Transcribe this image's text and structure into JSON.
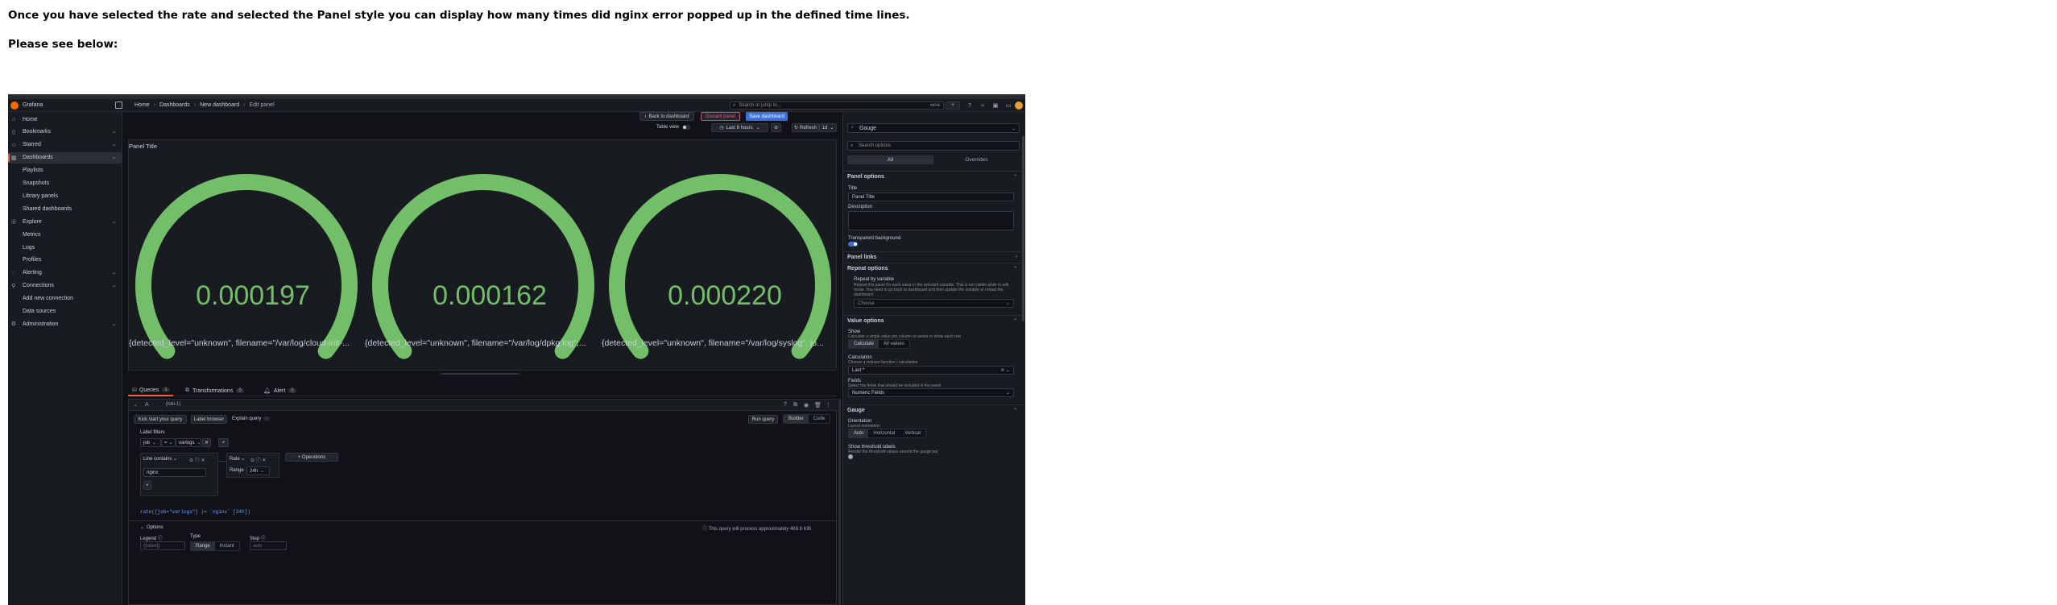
{
  "document": {
    "line1": "Once you have selected the rate and selected the Panel style you can display how many times did nginx error popped up in the defined time lines.",
    "line2": "Please see below:"
  },
  "nav": {
    "app_name": "Grafana",
    "breadcrumbs": [
      "Home",
      "Dashboards",
      "New dashboard",
      "Edit panel"
    ],
    "search_placeholder": "Search or jump to...",
    "search_shortcut": "ctrl+k",
    "new_label": "+"
  },
  "sidebar": {
    "items": [
      {
        "label": "Home",
        "icon": "home-icon",
        "sub": false,
        "chevron": false
      },
      {
        "label": "Bookmarks",
        "icon": "bookmark-icon",
        "sub": false,
        "chevron": true
      },
      {
        "label": "Starred",
        "icon": "star-icon",
        "sub": false,
        "chevron": true
      },
      {
        "label": "Dashboards",
        "icon": "dashboards-icon",
        "sub": false,
        "chevron": true,
        "active": true
      },
      {
        "label": "Playlists",
        "sub": true
      },
      {
        "label": "Snapshots",
        "sub": true
      },
      {
        "label": "Library panels",
        "sub": true
      },
      {
        "label": "Shared dashboards",
        "sub": true
      },
      {
        "label": "Explore",
        "icon": "compass-icon",
        "sub": false,
        "chevron": true
      },
      {
        "label": "Metrics",
        "sub": true
      },
      {
        "label": "Logs",
        "sub": true
      },
      {
        "label": "Profiles",
        "sub": true
      },
      {
        "label": "Alerting",
        "icon": "bell-icon",
        "sub": false,
        "chevron": true
      },
      {
        "label": "Connections",
        "icon": "plug-icon",
        "sub": false,
        "chevron": true
      },
      {
        "label": "Add new connection",
        "sub": true
      },
      {
        "label": "Data sources",
        "sub": true
      },
      {
        "label": "Administration",
        "icon": "gear-icon",
        "sub": false,
        "chevron": true
      }
    ]
  },
  "toolbar": {
    "back_to_dashboard": "Back to dashboard",
    "discard_panel": "Discard panel",
    "save_dashboard": "Save dashboard",
    "table_view": "Table view",
    "time_range": "Last 6 hours",
    "refresh": "Refresh",
    "refresh_interval": "1d"
  },
  "panel": {
    "title": "Panel Title",
    "gauges": [
      {
        "value": "0.000197",
        "fraction": 1.0,
        "label": "{detected_level=\"unknown\", filename=\"/var/log/cloud-init-..."
      },
      {
        "value": "0.000162",
        "fraction": 1.0,
        "label": "{detected_level=\"unknown\", filename=\"/var/log/dpkg.log\",..."
      },
      {
        "value": "0.000220",
        "fraction": 1.0,
        "label": "{detected_level=\"unknown\", filename=\"/var/log/syslog\", jo..."
      }
    ],
    "gauge_color": "#73bf69"
  },
  "tabs": [
    {
      "label": "Queries",
      "count": "1",
      "icon": "database-icon"
    },
    {
      "label": "Transformations",
      "count": "0",
      "icon": "transform-icon"
    },
    {
      "label": "Alert",
      "count": "0",
      "icon": "bell-icon"
    }
  ],
  "query": {
    "ref_id": "A",
    "datasource": "(loki-1)",
    "kick_start": "Kick start your query",
    "label_browser": "Label browser",
    "explain_query": "Explain query",
    "run_query": "Run query",
    "builder": "Builder",
    "code": "Code",
    "label_filters": "Label filters",
    "filter_label": "job",
    "filter_op": "=",
    "filter_value": "varlogs",
    "op1_name": "Line contains",
    "op1_value": "nginx",
    "op2_name": "Rate",
    "op2_range_label": "Range",
    "op2_range_value": "24h",
    "operations_btn": "+ Operations",
    "expr_prefix": "rate({job=\"varlogs\"} |= `nginx` [24h])",
    "options_label": "Options",
    "process_note": "This query will process approximately 469.8 KiB.",
    "legend_label": "Legend",
    "legend_placeholder": "{{label}}",
    "type_label": "Type",
    "type_range": "Range",
    "type_instant": "Instant",
    "step_label": "Step",
    "step_placeholder": "auto"
  },
  "options_pane": {
    "viz_name": "Gauge",
    "search_placeholder": "Search options",
    "tab_all": "All",
    "tab_overrides": "Overrides",
    "panel_options": "Panel options",
    "title_label": "Title",
    "title_value": "Panel Title",
    "description_label": "Description",
    "transparent_label": "Transparent background",
    "panel_links": "Panel links",
    "repeat_options": "Repeat options",
    "repeat_by_variable": "Repeat by variable",
    "repeat_desc": "Repeat this panel for each value in the selected variable. This is not visible while in edit mode. You need to go back to dashboard and then update the variable or reload the dashboard.",
    "choose": "Choose",
    "value_options": "Value options",
    "show_label": "Show",
    "show_desc": "Calculate a single value per column or series or show each row",
    "show_calculate": "Calculate",
    "show_all_values": "All values",
    "calculation_label": "Calculation",
    "calculation_desc": "Choose a reducer function / calculation",
    "calculation_value": "Last *",
    "fields_label": "Fields",
    "fields_desc": "Select the fields that should be included in the panel",
    "fields_value": "Numeric Fields",
    "gauge_section": "Gauge",
    "orientation_label": "Orientation",
    "orientation_desc": "Layout orientation",
    "orient_auto": "Auto",
    "orient_horizontal": "Horizontal",
    "orient_vertical": "Vertical",
    "threshold_labels": "Show threshold labels",
    "threshold_desc": "Render the threshold values around the gauge bar"
  }
}
